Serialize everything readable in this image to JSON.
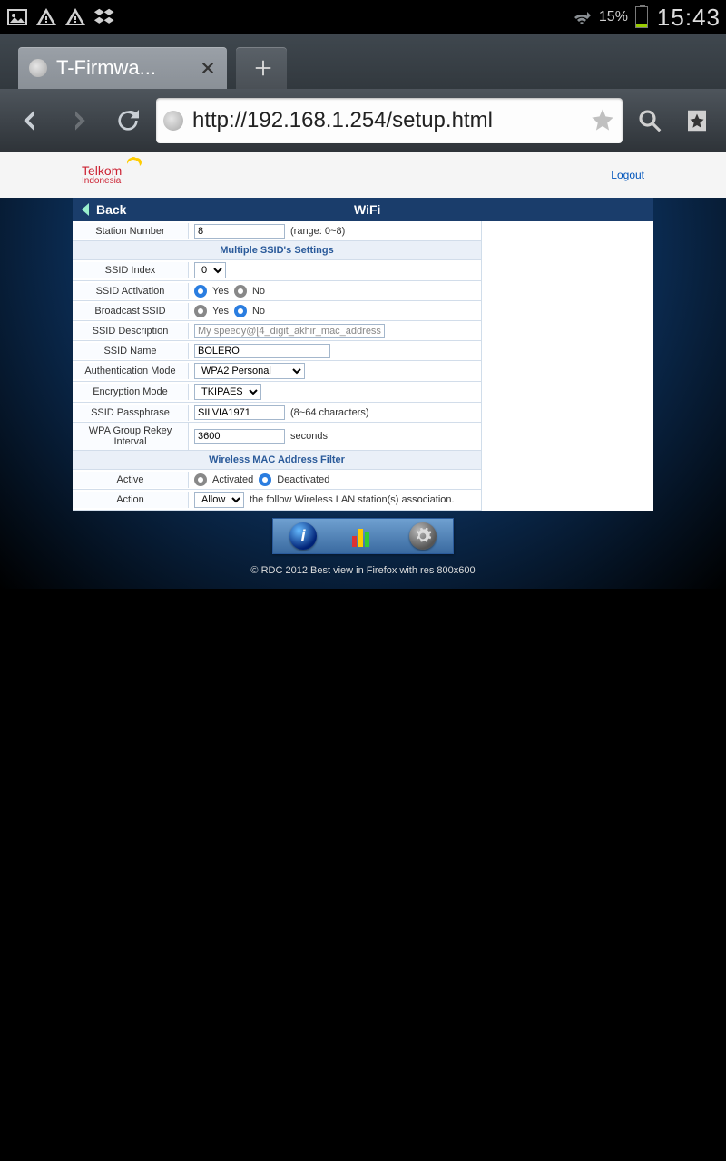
{
  "status": {
    "battery_pct": "15%",
    "clock": "15:43"
  },
  "browser": {
    "tab_title": "T-Firmwa...",
    "url": "http://192.168.1.254/setup.html"
  },
  "header": {
    "brand_line1": "Telkom",
    "brand_line2": "Indonesia",
    "logout": "Logout"
  },
  "titlebar": {
    "back": "Back",
    "title": "WiFi"
  },
  "sections": {
    "multi_ssid": "Multiple SSID's Settings",
    "mac_filter": "Wireless MAC Address Filter"
  },
  "labels": {
    "station_number": "Station Number",
    "ssid_index": "SSID Index",
    "ssid_activation": "SSID Activation",
    "broadcast_ssid": "Broadcast SSID",
    "ssid_description": "SSID Description",
    "ssid_name": "SSID Name",
    "auth_mode": "Authentication Mode",
    "enc_mode": "Encryption Mode",
    "passphrase": "SSID Passphrase",
    "rekey": "WPA Group Rekey Interval",
    "active": "Active",
    "action": "Action"
  },
  "values": {
    "station_number": "8",
    "station_number_hint": "(range: 0~8)",
    "ssid_index": "0",
    "yes": "Yes",
    "no": "No",
    "ssid_description": "My speedy@[4_digit_akhir_mac_address]",
    "ssid_name": "BOLERO",
    "auth_mode": "WPA2 Personal",
    "enc_mode": "TKIPAES",
    "passphrase": "SILVIA1971",
    "passphrase_hint": "(8~64 characters)",
    "rekey": "3600",
    "rekey_unit": "seconds",
    "activated": "Activated",
    "deactivated": "Deactivated",
    "action_value": "Allow",
    "action_hint": "the follow Wireless LAN station(s) association."
  },
  "footer": {
    "copyright": "© RDC 2012 Best view in Firefox with res 800x600"
  }
}
